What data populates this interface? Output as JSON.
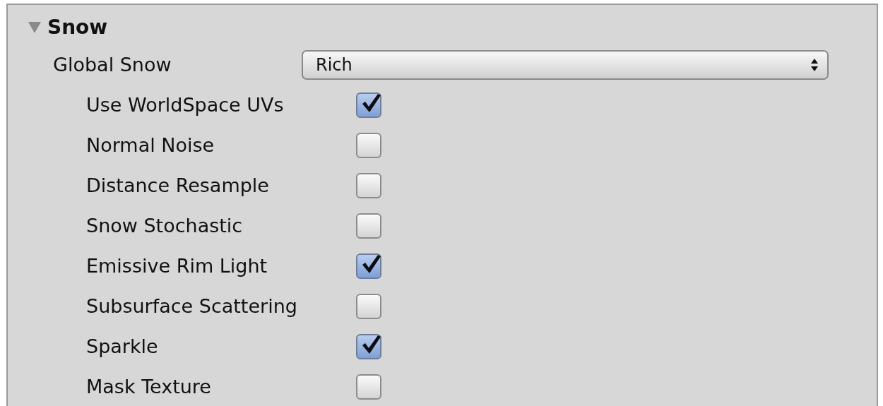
{
  "section": {
    "title": "Snow",
    "expanded": true,
    "global_snow": {
      "label": "Global Snow",
      "value": "Rich"
    },
    "options": [
      {
        "label": "Use WorldSpace UVs",
        "checked": true
      },
      {
        "label": "Normal Noise",
        "checked": false
      },
      {
        "label": "Distance Resample",
        "checked": false
      },
      {
        "label": "Snow Stochastic",
        "checked": false
      },
      {
        "label": "Emissive Rim Light",
        "checked": true
      },
      {
        "label": "Subsurface Scattering",
        "checked": false
      },
      {
        "label": "Sparkle",
        "checked": true
      },
      {
        "label": "Mask Texture",
        "checked": false
      }
    ]
  }
}
